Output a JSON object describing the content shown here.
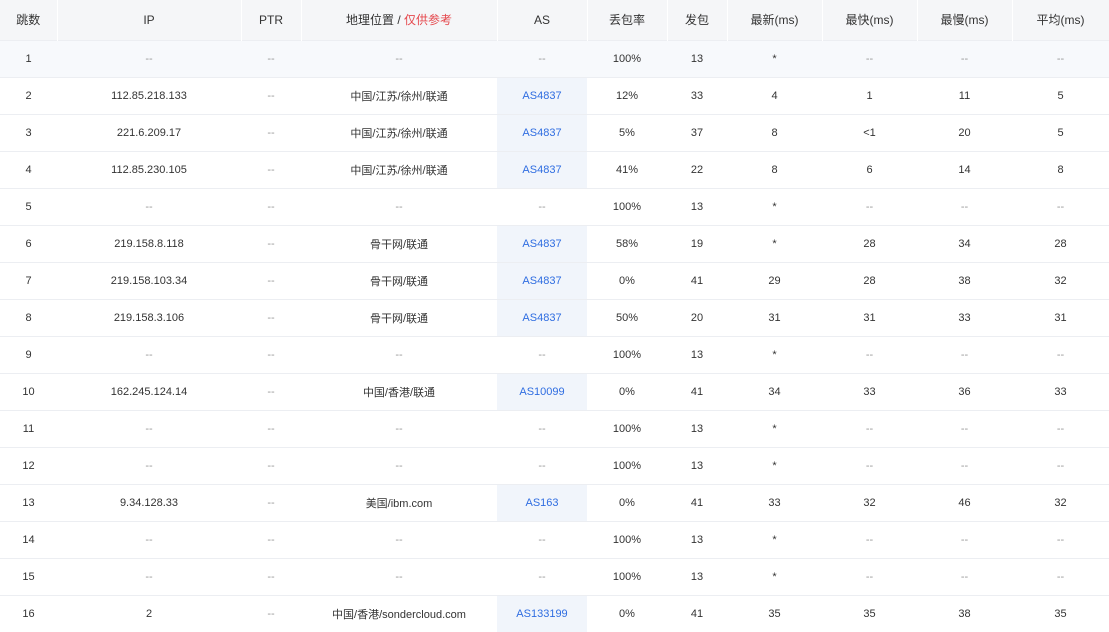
{
  "headers": {
    "hop": "跳数",
    "ip": "IP",
    "ptr": "PTR",
    "geo": "地理位置",
    "geo_sep": " / ",
    "geo_hint": "仅供参考",
    "as": "AS",
    "loss": "丢包率",
    "sent": "发包",
    "last": "最新(ms)",
    "best": "最快(ms)",
    "worst": "最慢(ms)",
    "avg": "平均(ms)"
  },
  "rows": [
    {
      "hop": "1",
      "ip": "--",
      "ptr": "--",
      "geo": "--",
      "as": "--",
      "loss": "100%",
      "sent": "13",
      "last": "*",
      "best": "--",
      "worst": "--",
      "avg": "--"
    },
    {
      "hop": "2",
      "ip": "112.85.218.133",
      "ptr": "--",
      "geo": "中国/江苏/徐州/联通",
      "as": "AS4837",
      "loss": "12%",
      "sent": "33",
      "last": "4",
      "best": "1",
      "worst": "11",
      "avg": "5"
    },
    {
      "hop": "3",
      "ip": "221.6.209.17",
      "ptr": "--",
      "geo": "中国/江苏/徐州/联通",
      "as": "AS4837",
      "loss": "5%",
      "sent": "37",
      "last": "8",
      "best": "<1",
      "worst": "20",
      "avg": "5"
    },
    {
      "hop": "4",
      "ip": "112.85.230.105",
      "ptr": "--",
      "geo": "中国/江苏/徐州/联通",
      "as": "AS4837",
      "loss": "41%",
      "sent": "22",
      "last": "8",
      "best": "6",
      "worst": "14",
      "avg": "8"
    },
    {
      "hop": "5",
      "ip": "--",
      "ptr": "--",
      "geo": "--",
      "as": "--",
      "loss": "100%",
      "sent": "13",
      "last": "*",
      "best": "--",
      "worst": "--",
      "avg": "--"
    },
    {
      "hop": "6",
      "ip": "219.158.8.118",
      "ptr": "--",
      "geo": "骨干网/联通",
      "as": "AS4837",
      "loss": "58%",
      "sent": "19",
      "last": "*",
      "best": "28",
      "worst": "34",
      "avg": "28"
    },
    {
      "hop": "7",
      "ip": "219.158.103.34",
      "ptr": "--",
      "geo": "骨干网/联通",
      "as": "AS4837",
      "loss": "0%",
      "sent": "41",
      "last": "29",
      "best": "28",
      "worst": "38",
      "avg": "32"
    },
    {
      "hop": "8",
      "ip": "219.158.3.106",
      "ptr": "--",
      "geo": "骨干网/联通",
      "as": "AS4837",
      "loss": "50%",
      "sent": "20",
      "last": "31",
      "best": "31",
      "worst": "33",
      "avg": "31"
    },
    {
      "hop": "9",
      "ip": "--",
      "ptr": "--",
      "geo": "--",
      "as": "--",
      "loss": "100%",
      "sent": "13",
      "last": "*",
      "best": "--",
      "worst": "--",
      "avg": "--"
    },
    {
      "hop": "10",
      "ip": "162.245.124.14",
      "ptr": "--",
      "geo": "中国/香港/联通",
      "as": "AS10099",
      "loss": "0%",
      "sent": "41",
      "last": "34",
      "best": "33",
      "worst": "36",
      "avg": "33"
    },
    {
      "hop": "11",
      "ip": "--",
      "ptr": "--",
      "geo": "--",
      "as": "--",
      "loss": "100%",
      "sent": "13",
      "last": "*",
      "best": "--",
      "worst": "--",
      "avg": "--"
    },
    {
      "hop": "12",
      "ip": "--",
      "ptr": "--",
      "geo": "--",
      "as": "--",
      "loss": "100%",
      "sent": "13",
      "last": "*",
      "best": "--",
      "worst": "--",
      "avg": "--"
    },
    {
      "hop": "13",
      "ip": "9.34.128.33",
      "ptr": "--",
      "geo": "美国/ibm.com",
      "as": "AS163",
      "loss": "0%",
      "sent": "41",
      "last": "33",
      "best": "32",
      "worst": "46",
      "avg": "32"
    },
    {
      "hop": "14",
      "ip": "--",
      "ptr": "--",
      "geo": "--",
      "as": "--",
      "loss": "100%",
      "sent": "13",
      "last": "*",
      "best": "--",
      "worst": "--",
      "avg": "--"
    },
    {
      "hop": "15",
      "ip": "--",
      "ptr": "--",
      "geo": "--",
      "as": "--",
      "loss": "100%",
      "sent": "13",
      "last": "*",
      "best": "--",
      "worst": "--",
      "avg": "--"
    },
    {
      "hop": "16",
      "ip": "2",
      "ptr": "--",
      "geo": "中国/香港/sondercloud.com",
      "as": "AS133199",
      "loss": "0%",
      "sent": "41",
      "last": "35",
      "best": "35",
      "worst": "38",
      "avg": "35"
    }
  ],
  "colors": {
    "header_bg": "#f5f6f8",
    "as_link": "#2f6de1",
    "hint_red": "#e5484d",
    "as_cell_bg": "#f1f5fb",
    "highlight_row_bg": "#f7f9fc"
  }
}
